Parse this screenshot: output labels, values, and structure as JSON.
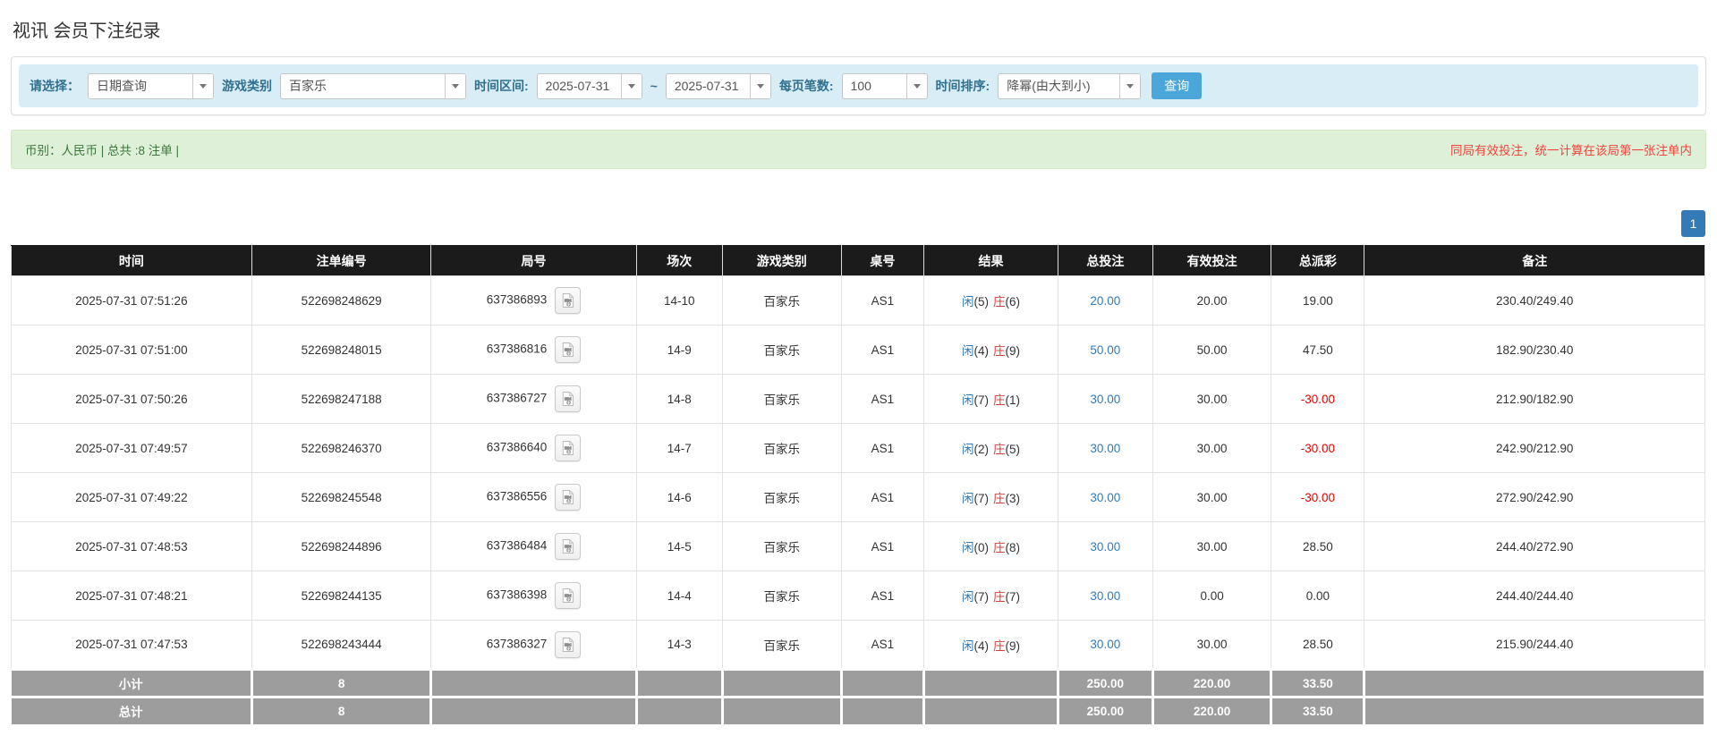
{
  "page": {
    "title": "视讯 会员下注纪录"
  },
  "filters": {
    "query_type_label": "请选择：",
    "query_type_value": "日期查询",
    "game_label": "游戏类别",
    "game_value": "百家乐",
    "range_label": "时间区间:",
    "date_from": "2025-07-31",
    "tilde": "~",
    "date_to": "2025-07-31",
    "page_size_label": "每页笔数:",
    "page_size_value": "100",
    "sort_label": "时间排序:",
    "sort_value": "降幂(由大到小)",
    "search_button": "查询"
  },
  "summary": {
    "left": "币别：人民币 | 总共 :8 注单 |",
    "right": "同局有效投注，统一计算在该局第一张注单内"
  },
  "pagination": {
    "current": "1"
  },
  "table": {
    "headers": [
      "时间",
      "注单编号",
      "局号",
      "场次",
      "游戏类别",
      "桌号",
      "结果",
      "总投注",
      "有效投注",
      "总派彩",
      "备注"
    ],
    "result_labels": {
      "player": "闲",
      "banker": "庄"
    },
    "rows": [
      {
        "time": "2025-07-31 07:51:26",
        "bet_id": "522698248629",
        "round_id": "637386893",
        "session": "14-10",
        "game": "百家乐",
        "table_no": "AS1",
        "player_score": "(5)",
        "banker_score": "(6)",
        "total_bet": "20.00",
        "valid_bet": "20.00",
        "payout": "19.00",
        "remark": "230.40/249.40"
      },
      {
        "time": "2025-07-31 07:51:00",
        "bet_id": "522698248015",
        "round_id": "637386816",
        "session": "14-9",
        "game": "百家乐",
        "table_no": "AS1",
        "player_score": "(4)",
        "banker_score": "(9)",
        "total_bet": "50.00",
        "valid_bet": "50.00",
        "payout": "47.50",
        "remark": "182.90/230.40"
      },
      {
        "time": "2025-07-31 07:50:26",
        "bet_id": "522698247188",
        "round_id": "637386727",
        "session": "14-8",
        "game": "百家乐",
        "table_no": "AS1",
        "player_score": "(7)",
        "banker_score": "(1)",
        "total_bet": "30.00",
        "valid_bet": "30.00",
        "payout": "-30.00",
        "remark": "212.90/182.90"
      },
      {
        "time": "2025-07-31 07:49:57",
        "bet_id": "522698246370",
        "round_id": "637386640",
        "session": "14-7",
        "game": "百家乐",
        "table_no": "AS1",
        "player_score": "(2)",
        "banker_score": "(5)",
        "total_bet": "30.00",
        "valid_bet": "30.00",
        "payout": "-30.00",
        "remark": "242.90/212.90"
      },
      {
        "time": "2025-07-31 07:49:22",
        "bet_id": "522698245548",
        "round_id": "637386556",
        "session": "14-6",
        "game": "百家乐",
        "table_no": "AS1",
        "player_score": "(7)",
        "banker_score": "(3)",
        "total_bet": "30.00",
        "valid_bet": "30.00",
        "payout": "-30.00",
        "remark": "272.90/242.90"
      },
      {
        "time": "2025-07-31 07:48:53",
        "bet_id": "522698244896",
        "round_id": "637386484",
        "session": "14-5",
        "game": "百家乐",
        "table_no": "AS1",
        "player_score": "(0)",
        "banker_score": "(8)",
        "total_bet": "30.00",
        "valid_bet": "30.00",
        "payout": "28.50",
        "remark": "244.40/272.90"
      },
      {
        "time": "2025-07-31 07:48:21",
        "bet_id": "522698244135",
        "round_id": "637386398",
        "session": "14-4",
        "game": "百家乐",
        "table_no": "AS1",
        "player_score": "(7)",
        "banker_score": "(7)",
        "total_bet": "30.00",
        "valid_bet": "0.00",
        "payout": "0.00",
        "remark": "244.40/244.40"
      },
      {
        "time": "2025-07-31 07:47:53",
        "bet_id": "522698243444",
        "round_id": "637386327",
        "session": "14-3",
        "game": "百家乐",
        "table_no": "AS1",
        "player_score": "(4)",
        "banker_score": "(9)",
        "total_bet": "30.00",
        "valid_bet": "30.00",
        "payout": "28.50",
        "remark": "215.90/244.40"
      }
    ],
    "footer": [
      {
        "label": "小计",
        "count": "8",
        "total_bet": "250.00",
        "valid_bet": "220.00",
        "payout": "33.50"
      },
      {
        "label": "总计",
        "count": "8",
        "total_bet": "250.00",
        "valid_bet": "220.00",
        "payout": "33.50"
      }
    ]
  },
  "colors": {
    "accent": "#337ab7",
    "filter_bg": "#d9edf7",
    "label_color": "#31708f",
    "button_bg": "#4ba6d9",
    "summary_bg": "#dff0d8",
    "summary_border": "#d6e9c6",
    "summary_text": "#3c763d",
    "note_red": "#f0453c",
    "negative_red": "#e60000",
    "header_bg": "#1b1b1b",
    "footer_bg": "#9d9d9d",
    "player_blue": "#337ab7",
    "banker_red": "#d43f3a"
  }
}
